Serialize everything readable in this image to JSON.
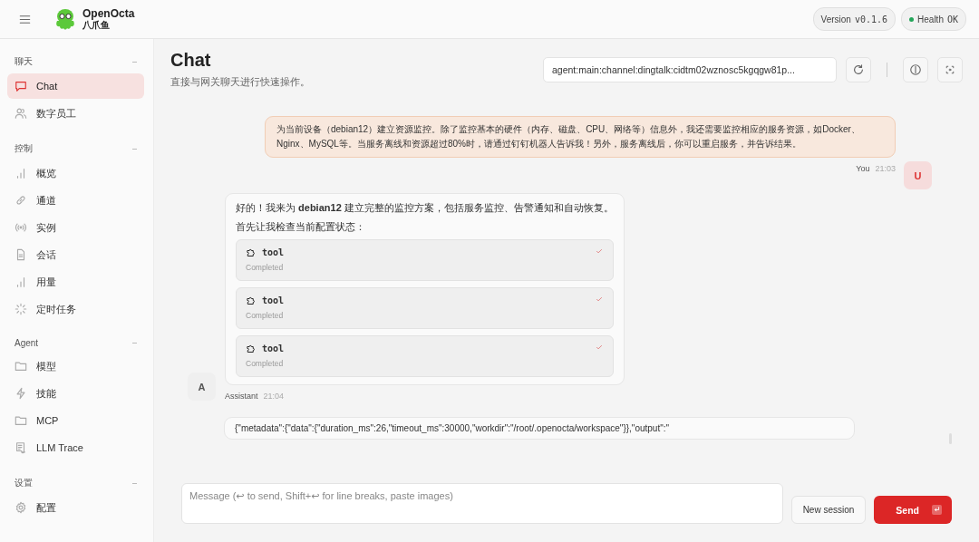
{
  "header": {
    "brand": "OpenOcta",
    "brand_sub": "八爪鱼",
    "version_label": "Version",
    "version": "v0.1.6",
    "health": {
      "label": "Health",
      "value": "OK",
      "color": "#22a559"
    }
  },
  "sidebar": {
    "groups": [
      {
        "title": "聊天",
        "items": [
          {
            "label": "Chat",
            "kind": "chat",
            "selected": true
          },
          {
            "label": "数字员工",
            "kind": "users",
            "selected": false
          }
        ]
      },
      {
        "title": "控制",
        "items": [
          {
            "label": "概览",
            "kind": "bars",
            "selected": false
          },
          {
            "label": "通道",
            "kind": "link",
            "selected": false
          },
          {
            "label": "实例",
            "kind": "signal",
            "selected": false
          },
          {
            "label": "会话",
            "kind": "file",
            "selected": false
          },
          {
            "label": "用量",
            "kind": "bars",
            "selected": false
          },
          {
            "label": "定时任务",
            "kind": "spinner",
            "selected": false
          }
        ]
      },
      {
        "title": "Agent",
        "items": [
          {
            "label": "模型",
            "kind": "folder",
            "selected": false
          },
          {
            "label": "技能",
            "kind": "bolt",
            "selected": false
          },
          {
            "label": "MCP",
            "kind": "folder",
            "selected": false
          },
          {
            "label": "LLM Trace",
            "kind": "scroll",
            "selected": false
          }
        ]
      },
      {
        "title": "设置",
        "items": [
          {
            "label": "配置",
            "kind": "gear",
            "selected": false
          }
        ]
      }
    ]
  },
  "page": {
    "title": "Chat",
    "subtitle": "直接与网关聊天进行快速操作。",
    "session": "agent:main:channel:dingtalk:cidtm02wznosc5kgqgw81p..."
  },
  "messages": [
    {
      "kind": "user",
      "avatar": "U",
      "text": "为当前设备（debian12）建立资源监控。除了监控基本的硬件（内存、磁盘、CPU、网络等）信息外，我还需要监控相应的服务资源，如Docker、Nginx、MySQL等。当服务离线和资源超过80%时，请通过钉钉机器人告诉我！另外，服务离线后，你可以重启服务，并告诉结果。",
      "sender": "You",
      "time": "21:03"
    },
    {
      "kind": "assistant",
      "avatar": "A",
      "paragraphs": [
        "好的！我来为 **debian12** 建立完整的监控方案，包括服务监控、告警通知和自动恢复。",
        "首先让我检查当前配置状态："
      ],
      "tools": [
        {
          "name": "tool",
          "status": "Completed",
          "completed": true
        },
        {
          "name": "tool",
          "status": "Completed",
          "completed": true
        },
        {
          "name": "tool",
          "status": "Completed",
          "completed": true
        }
      ],
      "sender": "Assistant",
      "time": "21:04"
    },
    {
      "kind": "output",
      "text": "{\"metadata\":{\"data\":{\"duration_ms\":26,\"timeout_ms\":30000,\"workdir\":\"/root/.openocta/workspace\"}},\"output\":\""
    }
  ],
  "composer": {
    "placeholder": "Message (↩ to send, Shift+↩ for line breaks, paste images)",
    "new_session": "New session",
    "send": "Send"
  }
}
